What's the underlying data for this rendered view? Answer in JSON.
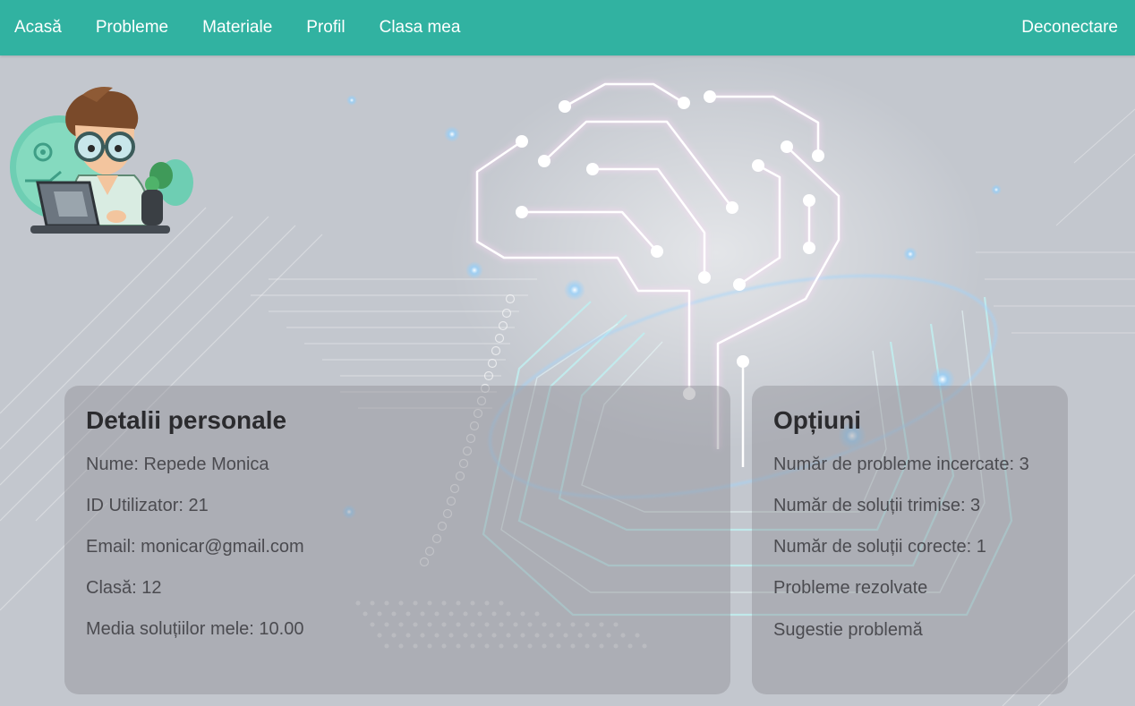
{
  "nav": {
    "items": [
      {
        "label": "Acasă"
      },
      {
        "label": "Probleme"
      },
      {
        "label": "Materiale"
      },
      {
        "label": "Profil"
      },
      {
        "label": "Clasa mea"
      }
    ],
    "logout_label": "Deconectare"
  },
  "personal": {
    "title": "Detalii personale",
    "name": "Nume: Repede Monica",
    "user_id": "ID Utilizator: 21",
    "email": "Email: monicar@gmail.com",
    "class": "Clasă: 12",
    "average": "Media soluțiilor mele: 10.00"
  },
  "options": {
    "title": "Opțiuni",
    "attempted": "Număr de probleme incercate: 3",
    "submitted": "Număr de soluții trimise: 3",
    "correct": "Număr de soluții corecte: 1",
    "solved_link": "Probleme rezolvate",
    "suggest_link": "Sugestie problemă"
  },
  "colors": {
    "nav_bg": "#31b2a1",
    "page_bg": "#c3c7ce",
    "card_bg": "rgba(140,140,148,0.42)"
  },
  "icons": {
    "mascot": "programmer-avatar",
    "background": "circuit-brain-illustration"
  }
}
